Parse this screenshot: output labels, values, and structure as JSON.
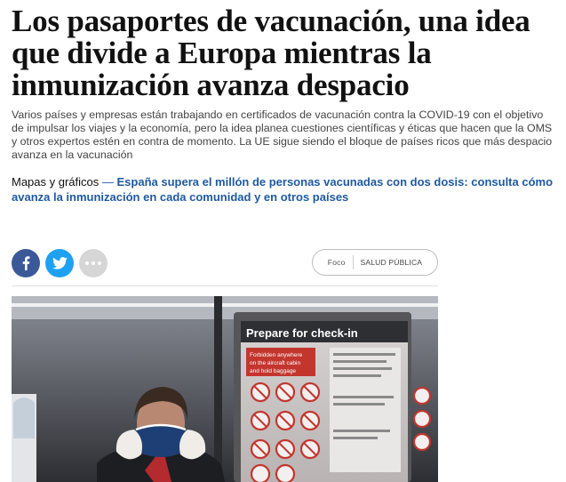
{
  "article": {
    "headline": "Los pasaportes de vacunación, una idea que divide a Europa mientras la inmunización avanza despacio",
    "subtitle": "Varios países y empresas están trabajando en certificados de vacunación contra la COVID-19 con el objetivo de impulsar los viajes y la economía, pero la idea planea cuestiones científicas y éticas que hacen que la OMS y otros expertos estén en contra de momento. La UE sigue siendo el bloque de países ricos que más despacio avanza en la vacunación",
    "related": {
      "kicker": "Mapas y gráficos",
      "separator": " — ",
      "link": "España supera el millón de personas vacunadas con dos dosis: consulta cómo avanza la inmunización en cada comunidad y en otros países"
    }
  },
  "share": {
    "facebook_icon": "facebook-icon",
    "twitter_icon": "twitter-icon",
    "more_icon": "more-dots-icon"
  },
  "tags": {
    "focus_label": "Foco",
    "topic": "SALUD PÚBLICA"
  },
  "photo": {
    "sign_title": "Prepare for check-in",
    "sign_line1": "Forbidden anywhere",
    "sign_line2": "on the aircraft cabin",
    "sign_line3": "and hold baggage"
  },
  "colors": {
    "link": "#1f5aa0",
    "facebook": "#3b5998",
    "twitter": "#1da1f2",
    "more": "#d6d6d6"
  }
}
